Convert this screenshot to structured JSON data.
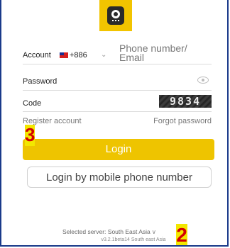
{
  "logo": {
    "icon": "app-logo-icon",
    "color": "#f2c400"
  },
  "account": {
    "label": "Account",
    "flag_icon": "taiwan-flag-icon",
    "country_code": "+886",
    "dropdown_icon": "chevron-down-icon",
    "placeholder": "Phone number/ Email"
  },
  "password": {
    "label": "Password",
    "toggle_icon": "eye-icon"
  },
  "code": {
    "label": "Code",
    "captcha": "9834"
  },
  "links": {
    "register": "Register account",
    "forgot": "Forgot password"
  },
  "buttons": {
    "login": "Login",
    "mobile_login": "Login by mobile phone number",
    "accent": "#eec400"
  },
  "server": {
    "label": "Selected server: South East Asia",
    "chevron": "∨"
  },
  "version": "v3.2.1beta14 South east Asia",
  "annotations": {
    "marker_3": "3",
    "marker_2": "2",
    "marker_color": "#f2e700",
    "text_color": "#d40000"
  }
}
